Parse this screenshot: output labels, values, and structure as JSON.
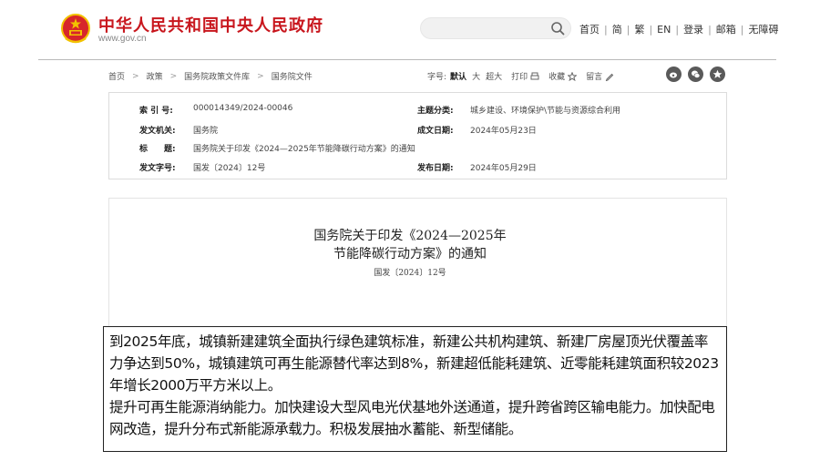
{
  "header": {
    "site_title": "中华人民共和国中央人民政府",
    "site_url": "www.gov.cn",
    "search_placeholder": "",
    "nav": [
      "首页",
      "简",
      "繁",
      "EN",
      "登录",
      "邮箱",
      "无障碍"
    ]
  },
  "breadcrumb": [
    "首页",
    "政策",
    "国务院政策文件库",
    "国务院文件"
  ],
  "tools": {
    "font_size_label": "字号:",
    "font_default": "默认",
    "font_large": "大",
    "font_xlarge": "超大",
    "print": "打印",
    "favorite": "收藏",
    "comment": "留言"
  },
  "share_icons": [
    "weibo-icon",
    "wechat-icon",
    "more-icon"
  ],
  "info": {
    "index_label": "索 引 号:",
    "index_value": "000014349/2024-00046",
    "category_label": "主题分类:",
    "category_value": "城乡建设、环境保护\\节能与资源综合利用",
    "issuer_label": "发文机关:",
    "issuer_value": "国务院",
    "created_label": "成文日期:",
    "created_value": "2024年05月23日",
    "title_label": "标　　题:",
    "title_value": "国务院关于印发《2024—2025年节能降碳行动方案》的通知",
    "docno_label": "发文字号:",
    "docno_value": "国发〔2024〕12号",
    "published_label": "发布日期:",
    "published_value": "2024年05月29日"
  },
  "document": {
    "title_line1": "国务院关于印发《2024—2025年",
    "title_line2": "节能降碳行动方案》的通知",
    "doc_number": "国发〔2024〕12号"
  },
  "excerpt": {
    "paragraph1": "到2025年底，城镇新建建筑全面执行绿色建筑标准，新建公共机构建筑、新建厂房屋顶光伏覆盖率力争达到50%，城镇建筑可再生能源替代率达到8%，新建超低能耗建筑、近零能耗建筑面积较2023年增长2000万平方米以上。",
    "paragraph2": "提升可再生能源消纳能力。加快建设大型风电光伏基地外送通道，提升跨省跨区输电能力。加快配电网改造，提升分布式新能源承载力。积极发展抽水蓄能、新型储能。"
  },
  "colors": {
    "brand_red": "#c8161d",
    "emblem_gold": "#f2c200"
  }
}
